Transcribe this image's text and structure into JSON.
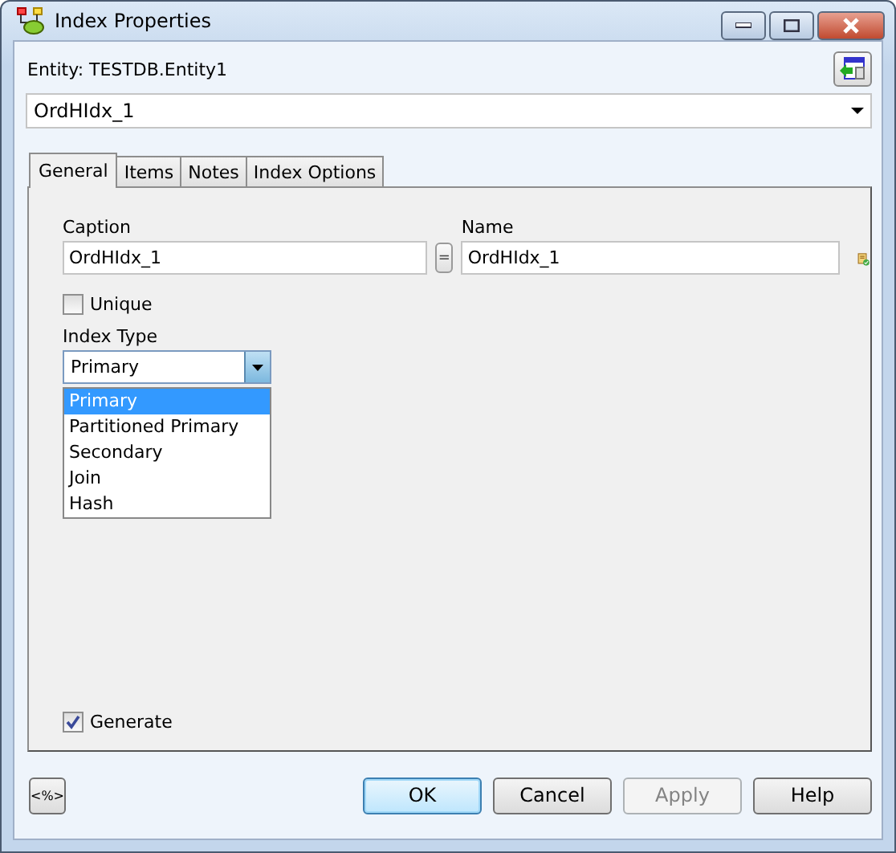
{
  "window": {
    "title": "Index Properties"
  },
  "entity_label": "Entity: TESTDB.Entity1",
  "index_select": {
    "value": "OrdHIdx_1"
  },
  "tabs": [
    {
      "label": "General",
      "selected": true
    },
    {
      "label": "Items",
      "selected": false
    },
    {
      "label": "Notes",
      "selected": false
    },
    {
      "label": "Index Options",
      "selected": false
    }
  ],
  "general": {
    "caption": {
      "label": "Caption",
      "value": "OrdHIdx_1"
    },
    "equals_button": "=",
    "name": {
      "label": "Name",
      "value": "OrdHIdx_1"
    },
    "unique": {
      "label": "Unique",
      "checked": false
    },
    "index_type": {
      "label": "Index Type",
      "value": "Primary",
      "expanded": true,
      "options": [
        {
          "label": "Primary",
          "selected": true
        },
        {
          "label": "Partitioned Primary",
          "selected": false
        },
        {
          "label": "Secondary",
          "selected": false
        },
        {
          "label": "Join",
          "selected": false
        },
        {
          "label": "Hash",
          "selected": false
        }
      ]
    },
    "generate": {
      "label": "Generate",
      "checked": true
    }
  },
  "buttons": [
    {
      "label": "<%>",
      "kind": "macro",
      "default": false,
      "disabled": false
    },
    {
      "label": "OK",
      "kind": "dialog",
      "default": true,
      "disabled": false
    },
    {
      "label": "Cancel",
      "kind": "dialog",
      "default": false,
      "disabled": false
    },
    {
      "label": "Apply",
      "kind": "dialog",
      "default": false,
      "disabled": true
    },
    {
      "label": "Help",
      "kind": "dialog",
      "default": false,
      "disabled": false
    }
  ]
}
